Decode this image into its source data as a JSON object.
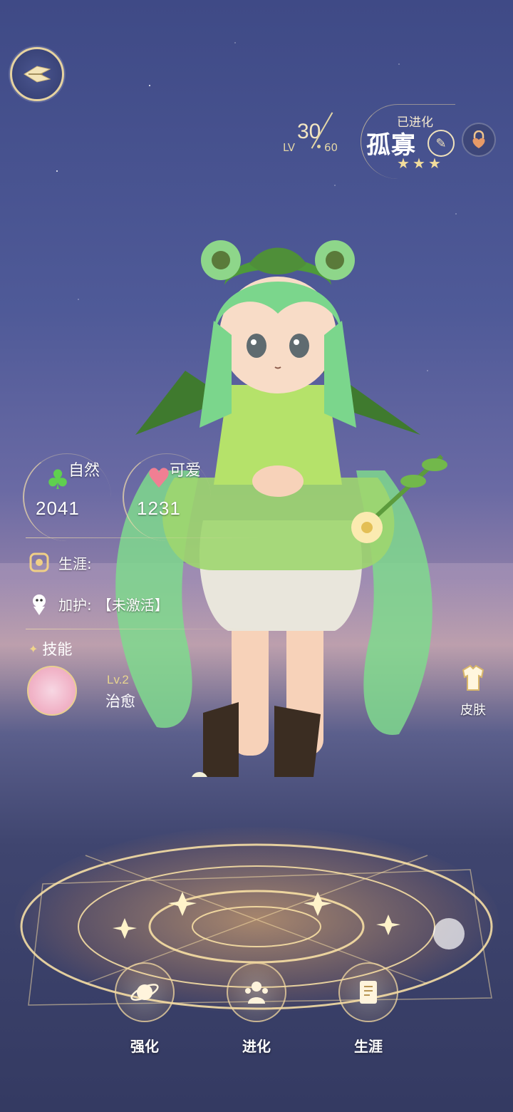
{
  "header": {
    "level_prefix": "LV",
    "level": "30",
    "level_max": "60",
    "status": "已进化",
    "name": "孤寡",
    "stars": 3
  },
  "stats": {
    "nature": {
      "label": "自然",
      "value": "2041"
    },
    "cute": {
      "label": "可爱",
      "value": "1231"
    }
  },
  "info": {
    "career_label": "生涯:",
    "blessing_label": "加护:",
    "blessing_value": "【未激活】"
  },
  "skills": {
    "title": "技能",
    "items": [
      {
        "level": "Lv.2",
        "name": "治愈"
      }
    ]
  },
  "side_buttons": {
    "skin": "皮肤"
  },
  "actions": [
    {
      "label": "强化"
    },
    {
      "label": "进化"
    },
    {
      "label": "生涯"
    }
  ],
  "colors": {
    "gold": "#e6d3a0",
    "sky_top": "#3f4a86",
    "character_green": "#7ed07f"
  }
}
